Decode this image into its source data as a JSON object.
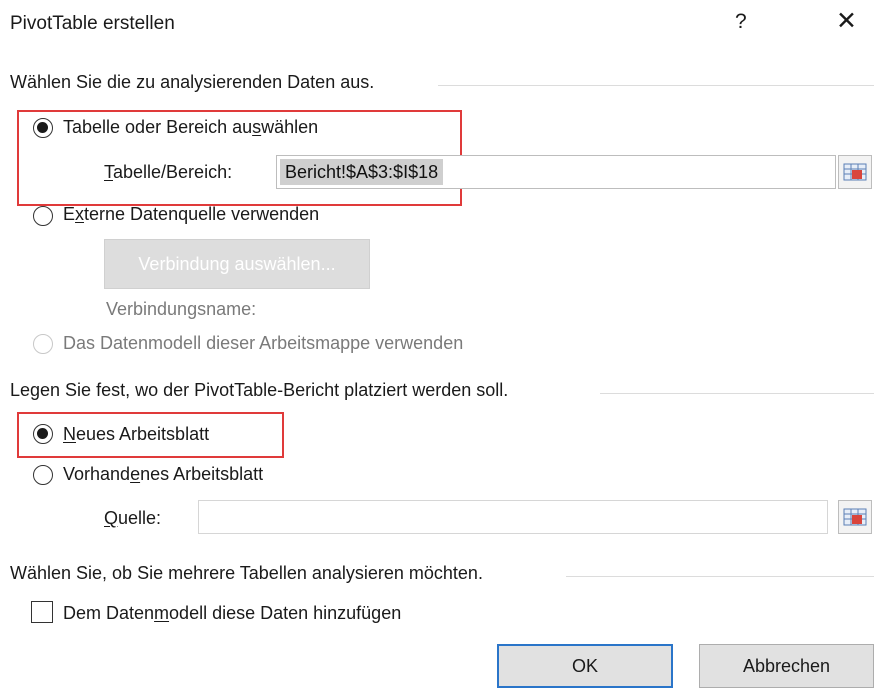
{
  "dialog": {
    "title": "PivotTable erstellen",
    "help_glyph": "?",
    "close_glyph": "✕"
  },
  "data_section": {
    "heading": "Wählen Sie die zu analysierenden Daten aus.",
    "option_table": {
      "pre": "Tabelle oder Bereich au",
      "u": "s",
      "post": "wählen",
      "checked": true
    },
    "range_label": {
      "pre": "",
      "u": "T",
      "post": "abelle/Bereich:"
    },
    "range_value": "Bericht!$A$3:$I$18",
    "option_external": {
      "pre": "E",
      "u": "x",
      "post": "terne Datenquelle verwenden",
      "checked": false
    },
    "choose_connection": "Verbindung auswählen...",
    "connection_name_label": "Verbindungsname:",
    "option_datamodel": {
      "label": "Das Datenmodell dieser Arbeitsmappe verwenden",
      "enabled": false
    }
  },
  "placement_section": {
    "heading": "Legen Sie fest, wo der PivotTable-Bericht platziert werden soll.",
    "option_new": {
      "pre": "",
      "u": "N",
      "post": "eues Arbeitsblatt",
      "checked": true
    },
    "option_existing": {
      "pre": "Vorhand",
      "u": "e",
      "post": "nes Arbeitsblatt",
      "checked": false
    },
    "source_label": {
      "pre": "",
      "u": "Q",
      "post": "uelle:"
    },
    "source_value": ""
  },
  "multi_section": {
    "heading": "Wählen Sie, ob Sie mehrere Tabellen analysieren möchten.",
    "add_datamodel": {
      "pre": "Dem Daten",
      "u": "m",
      "post": "odell diese Daten hinzufügen",
      "checked": false
    }
  },
  "buttons": {
    "ok": "OK",
    "cancel": "Abbrechen"
  },
  "colors": {
    "highlight": "#e03a3a",
    "ok_border": "#2a75c9"
  }
}
